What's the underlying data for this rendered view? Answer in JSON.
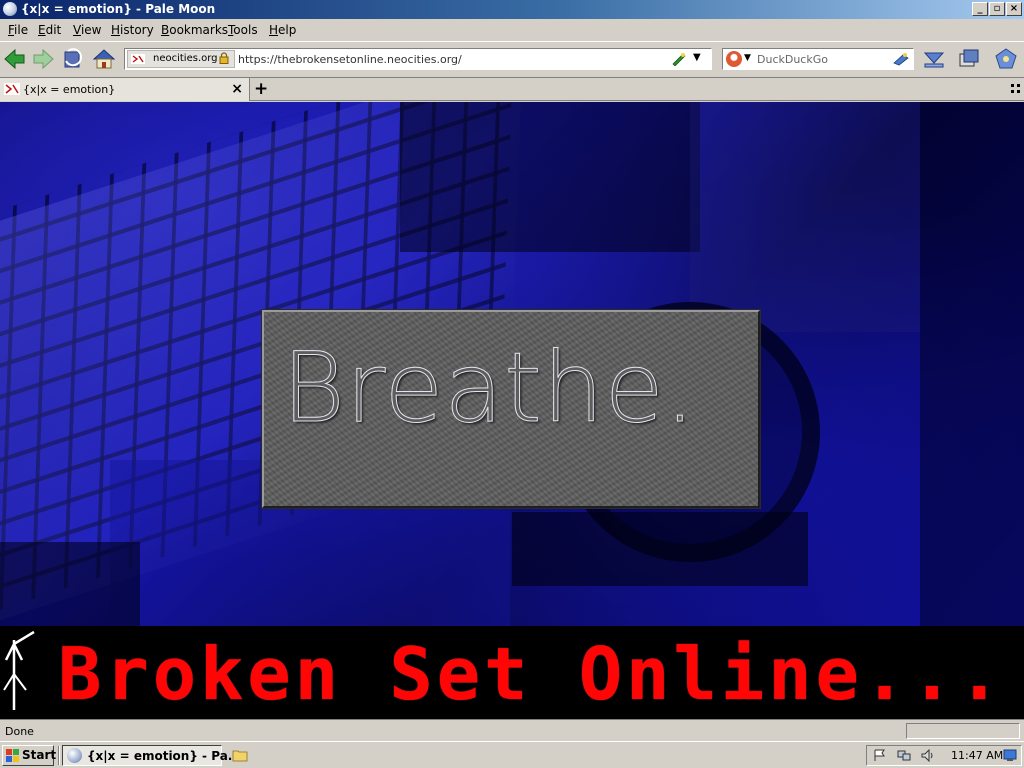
{
  "window": {
    "title": "{x|x = emotion} - Pale Moon"
  },
  "menu": {
    "items": [
      {
        "label": "File",
        "u": "F",
        "rest": "ile"
      },
      {
        "label": "Edit",
        "u": "E",
        "rest": "dit"
      },
      {
        "label": "View",
        "u": "V",
        "rest": "iew"
      },
      {
        "label": "History",
        "u": "H",
        "rest": "istory"
      },
      {
        "label": "Bookmarks",
        "u": "B",
        "rest": "ookmarks"
      },
      {
        "label": "Tools",
        "u": "T",
        "rest": "ools"
      },
      {
        "label": "Help",
        "u": "H",
        "rest": "elp"
      }
    ]
  },
  "toolbar": {
    "site_identity": "neocities.org",
    "url": "https://thebrokensetonline.neocities.org/",
    "search_placeholder": "DuckDuckGo"
  },
  "tabs": [
    {
      "title": "{x|x = emotion}"
    }
  ],
  "page": {
    "hero_text": "Breathe.",
    "banner_text": "Broken Set Online..."
  },
  "status": {
    "text": "Done"
  },
  "taskbar": {
    "start_label": "Start",
    "window_label": "{x|x = emotion} - Pa...",
    "clock": "11:47 AM"
  },
  "colors": {
    "banner_text": "#ff0505",
    "hero_blue": "#1616b8",
    "titlebar": "#0a246a"
  }
}
